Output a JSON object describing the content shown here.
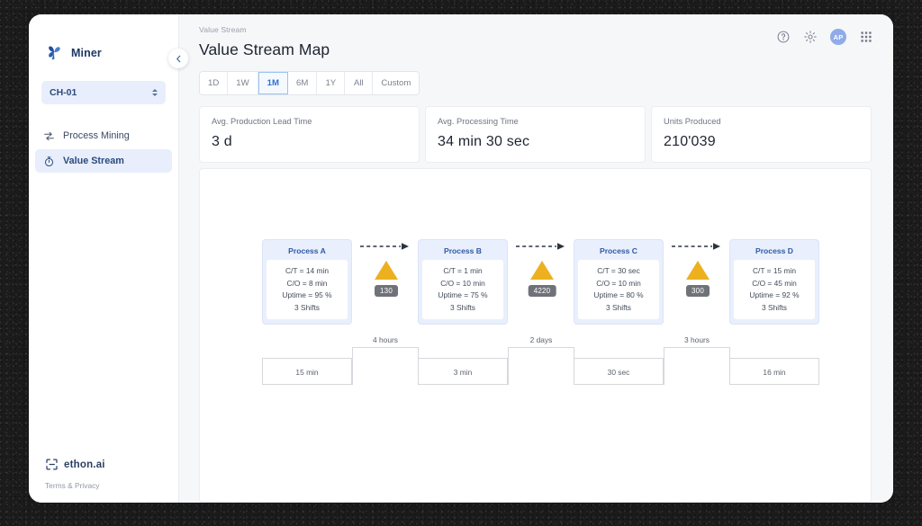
{
  "sidebar": {
    "brand": {
      "name": "Miner",
      "icon": "pinwheel-icon"
    },
    "selector": {
      "value": "CH-01",
      "icon": "stepper-icon"
    },
    "nav": [
      {
        "label": "Process Mining",
        "icon": "transfer-icon",
        "active": false
      },
      {
        "label": "Value Stream",
        "icon": "stopwatch-icon",
        "active": true
      }
    ],
    "footer": {
      "logo": "ethon.ai",
      "legal": "Terms & Privacy",
      "logo_icon": "bracket-icon"
    },
    "collapse": {
      "icon": "chevron-left-icon"
    }
  },
  "header": {
    "breadcrumb": "Value Stream",
    "title": "Value Stream Map",
    "icons": [
      {
        "name": "help-icon"
      },
      {
        "name": "gear-icon"
      },
      {
        "name": "avatar",
        "label": "AP"
      },
      {
        "name": "apps-grid-icon"
      }
    ]
  },
  "ranges": [
    {
      "label": "1D",
      "active": false
    },
    {
      "label": "1W",
      "active": false
    },
    {
      "label": "1M",
      "active": true
    },
    {
      "label": "6M",
      "active": false
    },
    {
      "label": "1Y",
      "active": false
    },
    {
      "label": "All",
      "active": false
    },
    {
      "label": "Custom",
      "active": false
    }
  ],
  "kpis": [
    {
      "label": "Avg. Production Lead Time",
      "value": "3 d"
    },
    {
      "label": "Avg. Processing Time",
      "value": "34 min 30 sec"
    },
    {
      "label": "Units Produced",
      "value": "210'039"
    }
  ],
  "colors": {
    "accent": "#2f6fd0",
    "process_fill": "#e9effc",
    "process_title": "#2e5aa8",
    "inventory_triangle": "#edb01f",
    "inventory_badge": "#6f7278",
    "page_bg": "#f6f7f9"
  },
  "vsm": {
    "processes": [
      {
        "title": "Process A",
        "metrics": [
          "C/T = 14 min",
          "C/O = 8 min",
          "Uptime = 95 %",
          "3 Shifts"
        ]
      },
      {
        "title": "Process B",
        "metrics": [
          "C/T = 1 min",
          "C/O = 10 min",
          "Uptime = 75 %",
          "3 Shifts"
        ]
      },
      {
        "title": "Process C",
        "metrics": [
          "C/T = 30 sec",
          "C/O = 10 min",
          "Uptime = 80 %",
          "3 Shifts"
        ]
      },
      {
        "title": "Process D",
        "metrics": [
          "C/T = 15 min",
          "C/O = 45 min",
          "Uptime = 92 %",
          "3 Shifts"
        ]
      }
    ],
    "inventories": [
      {
        "count": "130"
      },
      {
        "count": "4220"
      },
      {
        "count": "300"
      }
    ],
    "timeline": {
      "value_added": [
        "15 min",
        "3 min",
        "30 sec",
        "16 min"
      ],
      "wait_times": [
        "4 hours",
        "2 days",
        "3 hours"
      ]
    }
  },
  "chart_data": {
    "type": "diagram",
    "title": "Value Stream Map",
    "processes": [
      {
        "name": "Process A",
        "cycle_time": "14 min",
        "changeover": "8 min",
        "uptime_pct": 95,
        "shifts": 3,
        "value_added_time": "15 min"
      },
      {
        "name": "Process B",
        "cycle_time": "1 min",
        "changeover": "10 min",
        "uptime_pct": 75,
        "shifts": 3,
        "value_added_time": "3 min"
      },
      {
        "name": "Process C",
        "cycle_time": "30 sec",
        "changeover": "10 min",
        "uptime_pct": 80,
        "shifts": 3,
        "value_added_time": "30 sec"
      },
      {
        "name": "Process D",
        "cycle_time": "15 min",
        "changeover": "45 min",
        "uptime_pct": 92,
        "shifts": 3,
        "value_added_time": "16 min"
      }
    ],
    "inventory_buffers": [
      {
        "between": "Process A -> Process B",
        "units": 130
      },
      {
        "between": "Process B -> Process C",
        "units": 4220
      },
      {
        "between": "Process C -> Process D",
        "units": 300
      }
    ],
    "wait_times": [
      {
        "between": "Process A -> Process B",
        "duration": "4 hours"
      },
      {
        "between": "Process B -> Process C",
        "duration": "2 days"
      },
      {
        "between": "Process C -> Process D",
        "duration": "3 hours"
      }
    ],
    "summary": {
      "avg_production_lead_time": "3 d",
      "avg_processing_time": "34 min 30 sec",
      "units_produced": "210'039"
    }
  }
}
